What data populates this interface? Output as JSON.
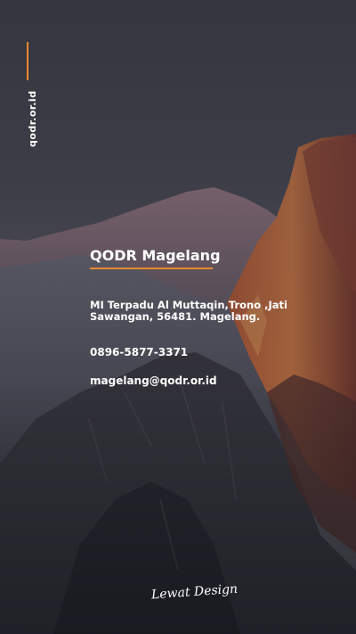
{
  "site": "qodr.or.id",
  "card": {
    "title": "QODR Magelang",
    "address": "MI Terpadu Al Muttaqin,Trono ,Jati Sawangan, 56481. Magelang.",
    "phone": "0896-5877-3371",
    "email": "magelang@qodr.or.id"
  },
  "signature": "Lewat Design",
  "colors": {
    "accent": "#e8892e",
    "text": "#ffffff"
  },
  "background_icon": "mountain-photo"
}
